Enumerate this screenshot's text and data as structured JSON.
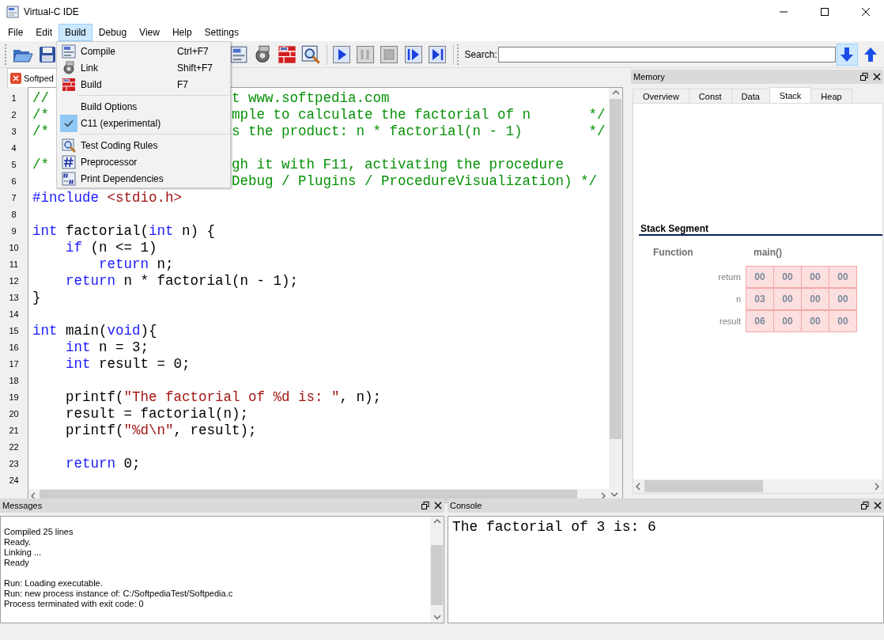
{
  "window": {
    "title": "Virtual-C IDE"
  },
  "menu_bar": [
    {
      "label": "File",
      "selected": false
    },
    {
      "label": "Edit",
      "selected": false
    },
    {
      "label": "Build",
      "selected": true
    },
    {
      "label": "Debug",
      "selected": false
    },
    {
      "label": "View",
      "selected": false
    },
    {
      "label": "Help",
      "selected": false
    },
    {
      "label": "Settings",
      "selected": false
    }
  ],
  "build_menu": [
    {
      "kind": "item",
      "label": "Compile",
      "shortcut": "Ctrl+F7",
      "checked": false
    },
    {
      "kind": "item",
      "label": "Link",
      "shortcut": "Shift+F7",
      "checked": false
    },
    {
      "kind": "item",
      "label": "Build",
      "shortcut": "F7",
      "checked": false
    },
    {
      "kind": "separator"
    },
    {
      "kind": "item",
      "label": "Build Options",
      "checked": false
    },
    {
      "kind": "item",
      "label": "C11 (experimental)",
      "checked": true
    },
    {
      "kind": "separator"
    },
    {
      "kind": "item",
      "label": "Test Coding Rules",
      "checked": false
    },
    {
      "kind": "item",
      "label": "Preprocessor",
      "checked": false
    },
    {
      "kind": "item",
      "label": "Print Dependencies",
      "checked": false
    }
  ],
  "toolbar": {
    "search_label": "Search:",
    "search_buttons": [
      {
        "selected": true
      },
      {
        "selected": false
      }
    ]
  },
  "editor": {
    "tab": {
      "label": "Softped"
    },
    "lines": [
      {
        "number": "1",
        "tokens": [
          {
            "kind": "comment",
            "text": "//                      t www.softpedia.com"
          }
        ]
      },
      {
        "number": "2",
        "tokens": [
          {
            "kind": "comment",
            "text": "/*                      mple to calculate the factorial of n       */"
          }
        ]
      },
      {
        "number": "3",
        "tokens": [
          {
            "kind": "comment",
            "text": "/*                      s the product: n * factorial(n - 1)        */"
          }
        ]
      },
      {
        "number": "4"
      },
      {
        "number": "5",
        "tokens": [
          {
            "kind": "comment",
            "text": "/*                      gh it with F11, activating the procedure"
          }
        ]
      },
      {
        "number": "6",
        "tokens": [
          {
            "kind": "comment",
            "text": "                        Debug / Plugins / ProcedureVisualization) */"
          }
        ]
      },
      {
        "number": "7",
        "tokens": [
          {
            "kind": "keyword",
            "text": "#include"
          },
          {
            "kind": "string",
            "text": " <stdio.h>"
          }
        ]
      },
      {
        "number": "8"
      },
      {
        "number": "9",
        "tokens": [
          {
            "kind": "keyword",
            "text": "int"
          },
          {
            "kind": "plain",
            "text": " factorial("
          },
          {
            "kind": "keyword",
            "text": "int"
          },
          {
            "kind": "plain",
            "text": " n) {"
          }
        ]
      },
      {
        "number": "10",
        "tokens": [
          {
            "kind": "keyword",
            "text": "    if"
          },
          {
            "kind": "plain",
            "text": " (n <= 1)"
          }
        ]
      },
      {
        "number": "11",
        "tokens": [
          {
            "kind": "keyword",
            "text": "        return"
          },
          {
            "kind": "plain",
            "text": " n;"
          }
        ]
      },
      {
        "number": "12",
        "tokens": [
          {
            "kind": "keyword",
            "text": "    return"
          },
          {
            "kind": "plain",
            "text": " n * factorial(n - 1);"
          }
        ]
      },
      {
        "number": "13",
        "tokens": [
          {
            "kind": "plain",
            "text": "}"
          }
        ]
      },
      {
        "number": "14"
      },
      {
        "number": "15",
        "tokens": [
          {
            "kind": "keyword",
            "text": "int"
          },
          {
            "kind": "plain",
            "text": " main("
          },
          {
            "kind": "keyword",
            "text": "void"
          },
          {
            "kind": "plain",
            "text": "){"
          }
        ]
      },
      {
        "number": "16",
        "tokens": [
          {
            "kind": "keyword",
            "text": "    int"
          },
          {
            "kind": "plain",
            "text": " n = 3;"
          }
        ]
      },
      {
        "number": "17",
        "tokens": [
          {
            "kind": "keyword",
            "text": "    int"
          },
          {
            "kind": "plain",
            "text": " result = 0;"
          }
        ]
      },
      {
        "number": "18"
      },
      {
        "number": "19",
        "tokens": [
          {
            "kind": "plain",
            "text": "    printf("
          },
          {
            "kind": "string",
            "text": "\"The factorial of %d is: \""
          },
          {
            "kind": "plain",
            "text": ", n);"
          }
        ]
      },
      {
        "number": "20",
        "tokens": [
          {
            "kind": "plain",
            "text": "    result = factorial(n);"
          }
        ]
      },
      {
        "number": "21",
        "tokens": [
          {
            "kind": "plain",
            "text": "    printf("
          },
          {
            "kind": "string",
            "text": "\"%d\\n\""
          },
          {
            "kind": "plain",
            "text": ", result);"
          }
        ]
      },
      {
        "number": "22"
      },
      {
        "number": "23",
        "tokens": [
          {
            "kind": "keyword",
            "text": "    return"
          },
          {
            "kind": "plain",
            "text": " 0;"
          }
        ]
      },
      {
        "number": "24"
      }
    ]
  },
  "memory": {
    "title": "Memory",
    "tabs": [
      {
        "label": "Overview",
        "selected": false
      },
      {
        "label": "Const",
        "selected": false
      },
      {
        "label": "Data",
        "selected": false
      },
      {
        "label": "Stack",
        "selected": true
      },
      {
        "label": "Heap",
        "selected": false
      }
    ],
    "section_title": "Stack Segment",
    "function_label": "Function",
    "function_name": "main()",
    "rows": [
      {
        "name": "return",
        "bytes": [
          "00",
          "00",
          "00",
          "00"
        ]
      },
      {
        "name": "n",
        "bytes": [
          "03",
          "00",
          "00",
          "00"
        ]
      },
      {
        "name": "result",
        "bytes": [
          "06",
          "00",
          "00",
          "00"
        ]
      }
    ]
  },
  "messages": {
    "title": "Messages",
    "groups": [
      [
        "Compiled 25 lines",
        "Ready.",
        "Linking ...",
        "Ready"
      ],
      [
        "Run: Loading executable.",
        "Run: new process instance of: C:/SoftpediaTest/Softpedia.c",
        "Process terminated with exit code: 0"
      ]
    ]
  },
  "console": {
    "title": "Console",
    "lines": [
      "The factorial of 3 is: 6"
    ]
  }
}
